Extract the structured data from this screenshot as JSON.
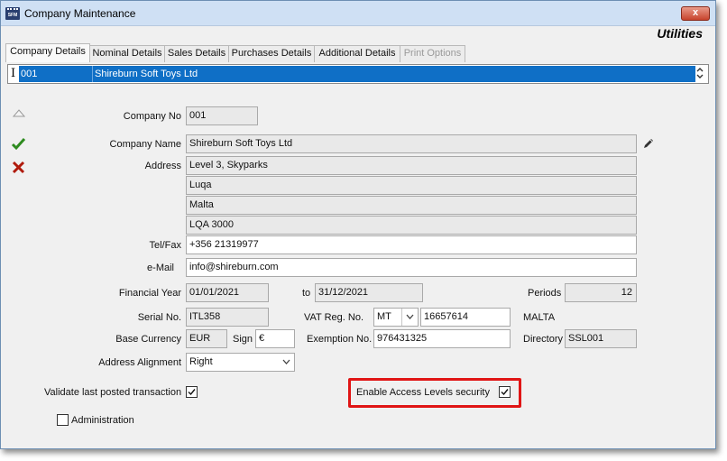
{
  "window": {
    "title": "Company Maintenance",
    "icon_text": "SFM",
    "close_label": "x",
    "section_title": "Utilities"
  },
  "tabs": [
    {
      "label": "Company Details",
      "active": true
    },
    {
      "label": "Nominal Details"
    },
    {
      "label": "Sales Details"
    },
    {
      "label": "Purchases Details"
    },
    {
      "label": "Additional Details"
    },
    {
      "label": "Print Options",
      "disabled": true
    }
  ],
  "selector": {
    "cursor": "I",
    "code": "001",
    "name": "Shireburn Soft Toys Ltd"
  },
  "form": {
    "company_no": {
      "label": "Company No",
      "value": "001"
    },
    "company_name": {
      "label": "Company Name",
      "value": "Shireburn Soft Toys Ltd"
    },
    "address": {
      "label": "Address",
      "lines": [
        "Level 3, Skyparks",
        "Luqa",
        "Malta",
        "LQA 3000"
      ]
    },
    "telfax": {
      "label": "Tel/Fax",
      "value": "+356 21319977"
    },
    "email": {
      "label": "e-Mail",
      "value": "info@shireburn.com"
    },
    "financial_year": {
      "label": "Financial Year",
      "from": "01/01/2021",
      "to_label": "to",
      "to": "31/12/2021"
    },
    "periods": {
      "label": "Periods",
      "value": "12"
    },
    "serial_no": {
      "label": "Serial No.",
      "value": "ITL358"
    },
    "vat_reg": {
      "label": "VAT Reg. No.",
      "country": "MT",
      "number": "16657614",
      "country_name": "MALTA"
    },
    "base_currency": {
      "label": "Base Currency",
      "value": "EUR"
    },
    "sign": {
      "label": "Sign",
      "value": "€"
    },
    "exemption_no": {
      "label": "Exemption No.",
      "value": "976431325"
    },
    "directory": {
      "label": "Directory",
      "value": "SSL001"
    },
    "address_alignment": {
      "label": "Address Alignment",
      "value": "Right"
    },
    "validate_last_posted": {
      "label": "Validate last posted transaction",
      "checked": true
    },
    "enable_access_levels": {
      "label": "Enable Access Levels security",
      "checked": true
    },
    "administration": {
      "label": "Administration",
      "checked": false
    }
  },
  "icons": {
    "up": "triangle-up-icon",
    "accept": "checkmark-icon",
    "cancel": "x-cross-icon",
    "edit": "pencil-icon"
  },
  "colors": {
    "selection": "#0f6fc6",
    "accept": "#2e8b1f",
    "cancel": "#b01a0c",
    "highlight": "#e01515"
  }
}
